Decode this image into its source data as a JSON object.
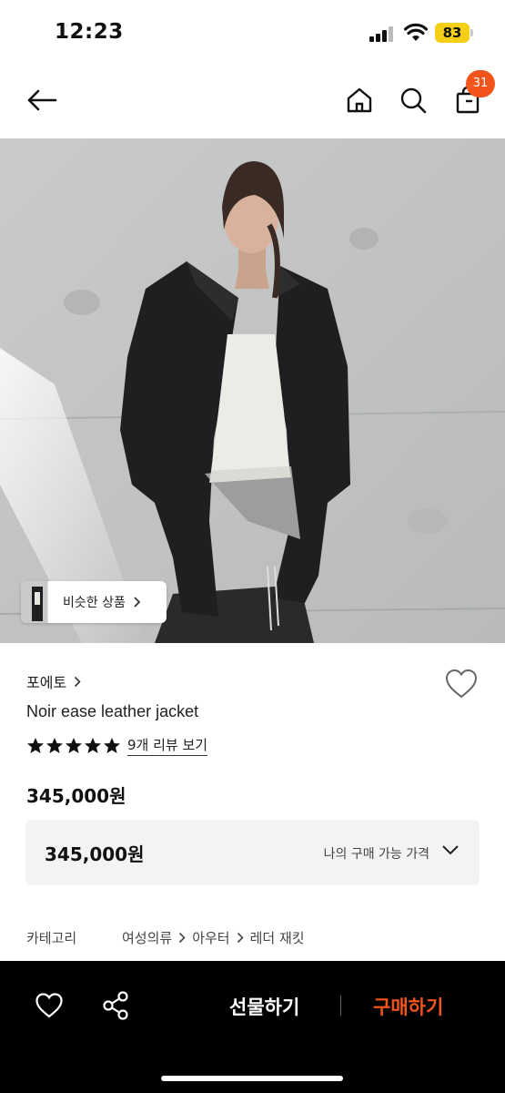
{
  "status_bar": {
    "time": "12:23",
    "battery": "83"
  },
  "header": {
    "cart_count": "31"
  },
  "image": {
    "similar_label": "비슷한 상품"
  },
  "product": {
    "brand": "포에토",
    "name": "Noir ease leather jacket",
    "rating_stars": 5,
    "review_link": "9개 리뷰 보기",
    "price": "345,000원"
  },
  "price_box": {
    "value": "345,000원",
    "label": "나의 구매 가능 가격"
  },
  "category": {
    "label": "카테고리",
    "path": [
      "여성의류",
      "아우터",
      "레더 재킷"
    ]
  },
  "bottom_bar": {
    "gift_label": "선물하기",
    "buy_label": "구매하기"
  },
  "colors": {
    "accent": "#f2541b",
    "battery": "#f5cf18",
    "bottom_bar": "#000000"
  }
}
